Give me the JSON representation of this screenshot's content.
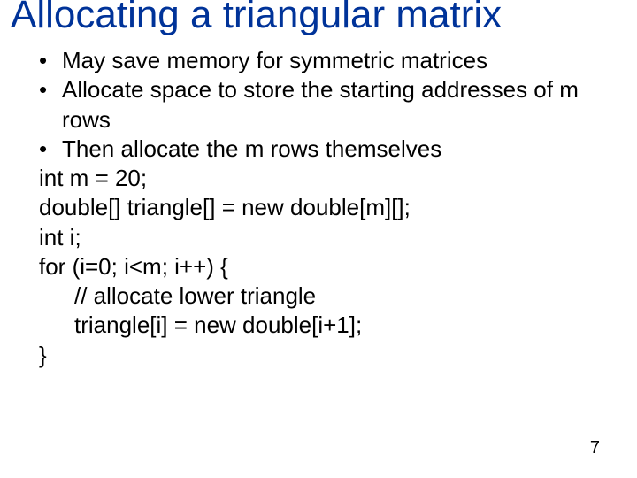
{
  "title": "Allocating a triangular matrix",
  "bullets": [
    "May save memory for symmetric matrices",
    "Allocate space to store the starting addresses of m rows",
    "Then allocate the m rows themselves"
  ],
  "code": {
    "l1": "int m = 20;",
    "l2": "double[] triangle[] = new double[m][];",
    "l3": "int i;",
    "l4": "for (i=0; i<m; i++) {",
    "l5": "// allocate lower triangle",
    "l6": "triangle[i] = new double[i+1];",
    "l7": "}"
  },
  "page_number": "7"
}
